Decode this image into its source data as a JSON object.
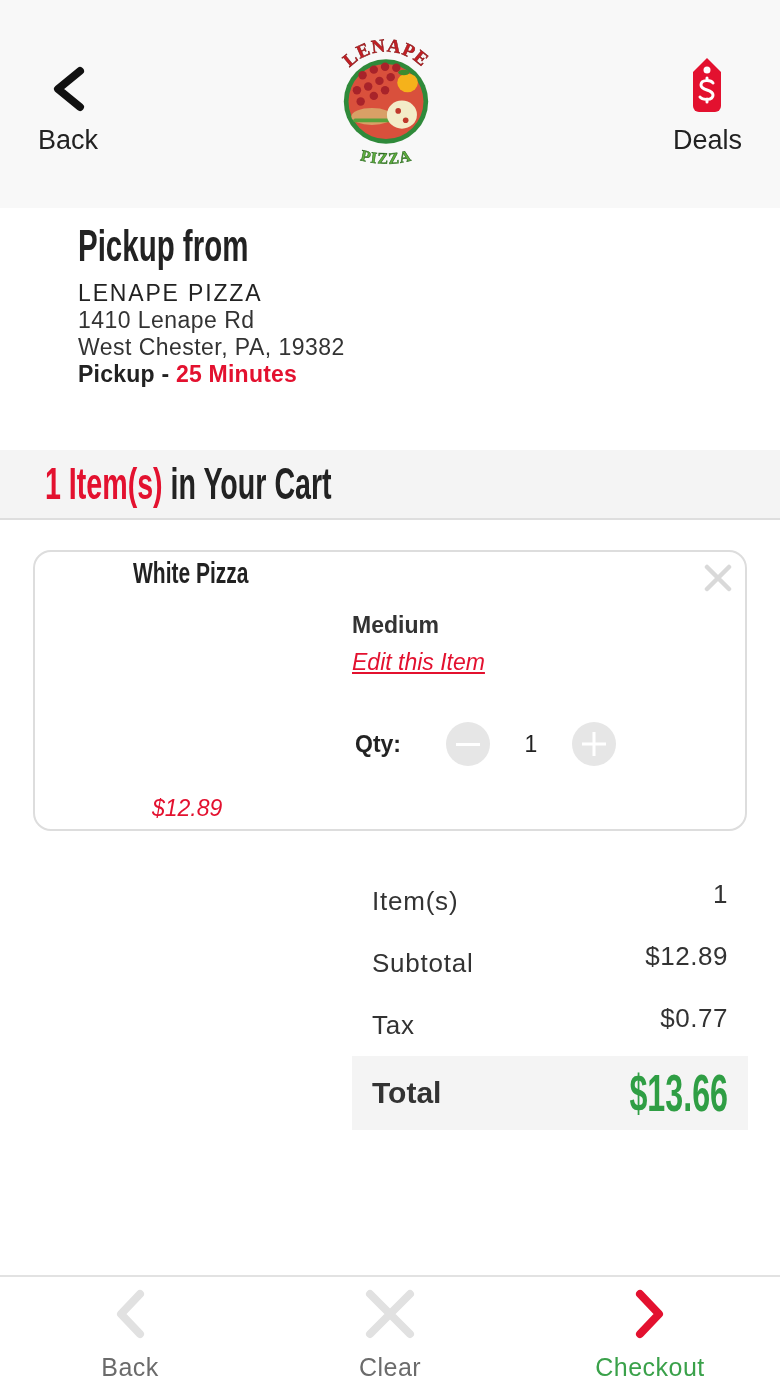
{
  "header": {
    "back_label": "Back",
    "logo": {
      "top_text": "LENAPE",
      "bottom_text": "PIZZA"
    },
    "deals_label": "Deals"
  },
  "pickup": {
    "title": "Pickup from",
    "store_name": "LENAPE PIZZA",
    "address_lines": [
      "1410 Lenape Rd",
      "West Chester, PA, 19382"
    ],
    "time_label": "Pickup -",
    "time_value": "25 Minutes"
  },
  "cart_heading": {
    "count": "1 Item(s)",
    "label": "in Your Cart"
  },
  "cart_items": [
    {
      "name": "White Pizza",
      "size": "Medium",
      "edit_link": "Edit this Item",
      "qty_label": "Qty:",
      "quantity": "1",
      "price": "$12.89"
    }
  ],
  "summary": {
    "rows": [
      {
        "label": "Item(s)",
        "value": "1"
      },
      {
        "label": "Subtotal",
        "value": "$12.89"
      },
      {
        "label": "Tax",
        "value": "$0.77"
      }
    ],
    "total": {
      "label": "Total",
      "value": "$13.66"
    }
  },
  "bottom_nav": [
    {
      "kind": "back",
      "label": "Back",
      "disabled": true
    },
    {
      "kind": "clear",
      "label": "Clear",
      "disabled": true
    },
    {
      "kind": "checkout",
      "label": "Checkout",
      "disabled": false
    }
  ]
}
